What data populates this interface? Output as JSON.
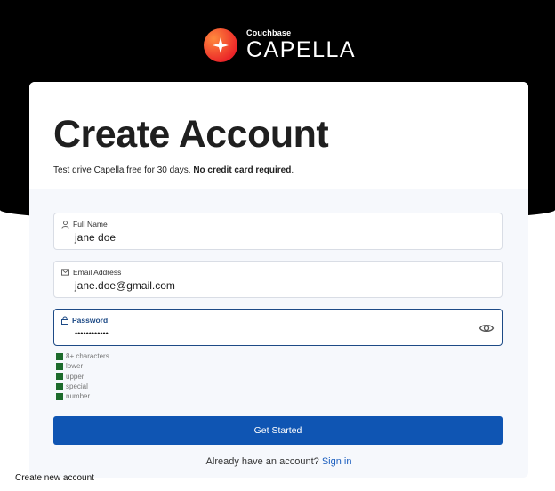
{
  "brand": {
    "small": "Couchbase",
    "name": "CAPELLA"
  },
  "header": {
    "title": "Create Account",
    "subtitle_prefix": "Test drive Capella free for 30 days. ",
    "subtitle_bold": "No credit card required",
    "subtitle_suffix": "."
  },
  "form": {
    "full_name": {
      "label": "Full Name",
      "value": "jane doe"
    },
    "email": {
      "label": "Email Address",
      "value": "jane.doe@gmail.com"
    },
    "password": {
      "label": "Password",
      "value": "••••••••••••"
    }
  },
  "requirements": [
    {
      "label": "8+ characters",
      "met": true
    },
    {
      "label": "lower",
      "met": true
    },
    {
      "label": "upper",
      "met": true
    },
    {
      "label": "special",
      "met": true
    },
    {
      "label": "number",
      "met": true
    }
  ],
  "cta": {
    "label": "Get Started"
  },
  "signin": {
    "prompt": "Already have an account? ",
    "link": "Sign in"
  },
  "caption": "Create new account",
  "colors": {
    "accent": "#0f55b3",
    "requirement_met": "#1d6b2c",
    "active_border": "#1d4a86"
  }
}
